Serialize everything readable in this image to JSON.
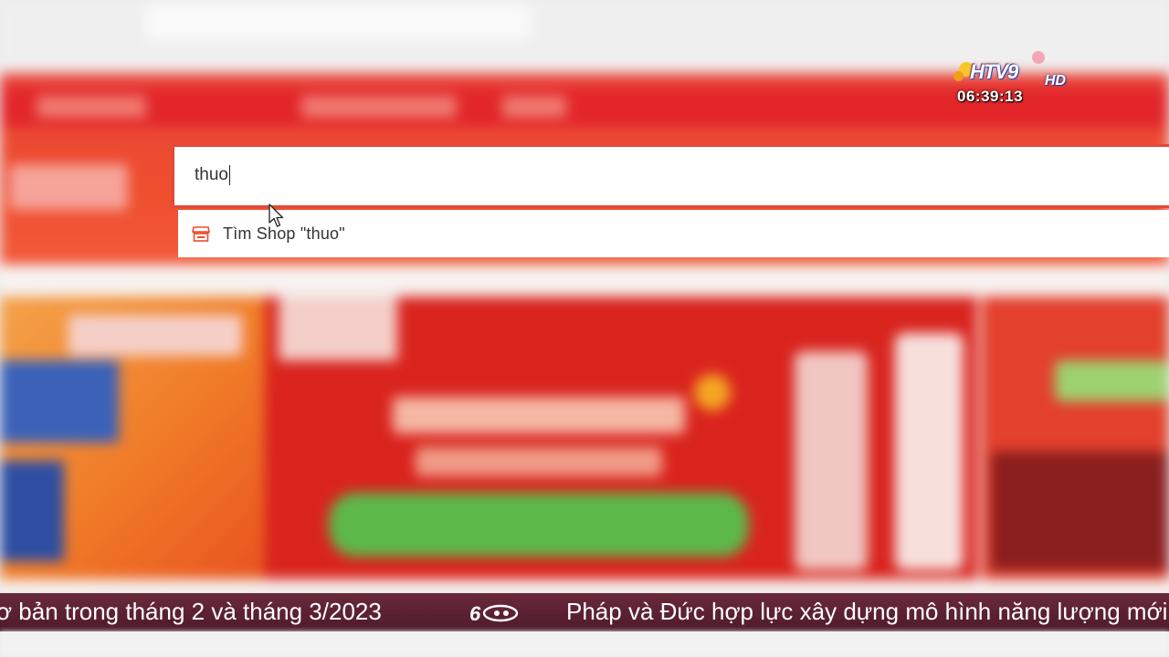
{
  "search": {
    "query": "thuo",
    "suggestion_label": "Tìm Shop \"thuo\""
  },
  "overlay": {
    "channel_name": "HTV9",
    "channel_suffix": "HD",
    "clock": "06:39:13"
  },
  "ticker": {
    "items": [
      "ơ bản trong tháng 2 và tháng 3/2023",
      "Pháp và Đức hợp lực xây dựng mô hình năng lượng mới"
    ]
  },
  "colors": {
    "brand_orange": "#ee4d2d",
    "search_border": "#e24a3a",
    "ticker_bg": "#5a2232"
  },
  "icons": {
    "suggestion": "shop-icon",
    "pointer": "mouse-cursor-icon",
    "ticker_separator": "htv-ticker-logo-icon"
  }
}
